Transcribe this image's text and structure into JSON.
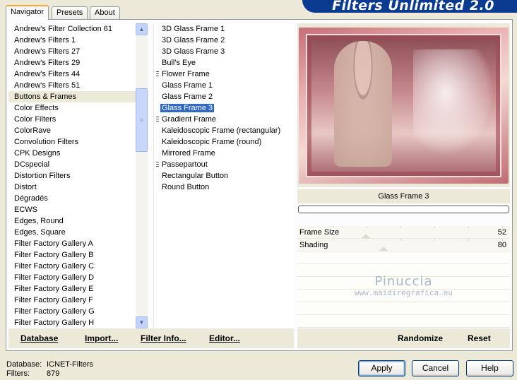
{
  "window_title": "Filters Unlimited 2.0",
  "tabs": [
    {
      "label": "Navigator",
      "active": true
    },
    {
      "label": "Presets",
      "active": false
    },
    {
      "label": "About",
      "active": false
    }
  ],
  "categories": [
    "Andrew's Filter Collection 61",
    "Andrew's Filters 1",
    "Andrew's Filters 27",
    "Andrew's Filters 29",
    "Andrew's Filters 44",
    "Andrew's Filters 51",
    "Buttons & Frames",
    "Color Effects",
    "Color Filters",
    "ColorRave",
    "Convolution Filters",
    "CPK Designs",
    "DCspecial",
    "Distortion Filters",
    "Distort",
    "Dégradés",
    "ECWS",
    "Edges, Round",
    "Edges, Square",
    "Filter Factory Gallery A",
    "Filter Factory Gallery B",
    "Filter Factory Gallery C",
    "Filter Factory Gallery D",
    "Filter Factory Gallery E",
    "Filter Factory Gallery F",
    "Filter Factory Gallery G",
    "Filter Factory Gallery H"
  ],
  "selected_category": "Buttons & Frames",
  "filters": [
    {
      "label": "3D Glass Frame 1",
      "marker": false
    },
    {
      "label": "3D Glass Frame 2",
      "marker": false
    },
    {
      "label": "3D Glass Frame 3",
      "marker": false
    },
    {
      "label": "Bull's Eye",
      "marker": false
    },
    {
      "label": "Flower Frame",
      "marker": true
    },
    {
      "label": "Glass Frame 1",
      "marker": false
    },
    {
      "label": "Glass Frame 2",
      "marker": false
    },
    {
      "label": "Glass Frame 3",
      "marker": false
    },
    {
      "label": "Gradient Frame",
      "marker": true
    },
    {
      "label": "Kaleidoscopic Frame (rectangular)",
      "marker": false
    },
    {
      "label": "Kaleidoscopic Frame (round)",
      "marker": false
    },
    {
      "label": "Mirrored Frame",
      "marker": false
    },
    {
      "label": "Passepartout",
      "marker": true
    },
    {
      "label": "Rectangular Button",
      "marker": false
    },
    {
      "label": "Round Button",
      "marker": false
    }
  ],
  "selected_filter": "Glass Frame 3",
  "left_buttons": {
    "database": "Database",
    "import": "Import...",
    "filter_info": "Filter Info...",
    "editor": "Editor..."
  },
  "effect_name": "Glass Frame 3",
  "sliders": [
    {
      "label": "Frame Size",
      "value": "52",
      "level": 52
    },
    {
      "label": "Shading",
      "value": "80",
      "level": 80
    }
  ],
  "watermark": {
    "name": "Pinuccia",
    "url": "www.maidiregrafica.eu"
  },
  "right_buttons": {
    "randomize": "Randomize",
    "reset": "Reset"
  },
  "status": {
    "database_label": "Database:",
    "database_value": "ICNET-Filters",
    "filters_label": "Filters:",
    "filters_value": "879"
  },
  "dialog_buttons": {
    "apply": "Apply",
    "cancel": "Cancel",
    "help": "Help"
  }
}
